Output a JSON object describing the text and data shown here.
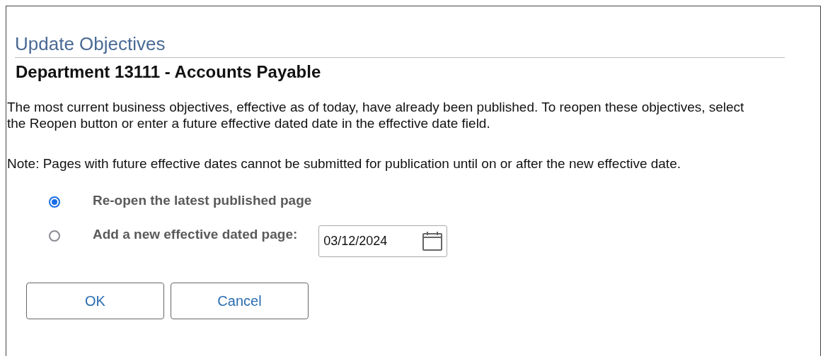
{
  "page_title": "Update Objectives",
  "heading": "Department 13111 - Accounts Payable",
  "paragraphs": [
    "The most current business objectives, effective as of today, have already been published. To reopen these objectives, select the Reopen button or enter a future effective dated date in the effective date field.",
    "Note: Pages with future effective dates cannot be submitted for publication until on or after the new effective date."
  ],
  "options": [
    {
      "label": "Re-open the latest published page",
      "selected": true,
      "kind": "plain"
    },
    {
      "label": "Add a new effective dated page:",
      "selected": false,
      "kind": "date",
      "date": "03/12/2024"
    }
  ],
  "buttons": [
    "OK",
    "Cancel"
  ]
}
